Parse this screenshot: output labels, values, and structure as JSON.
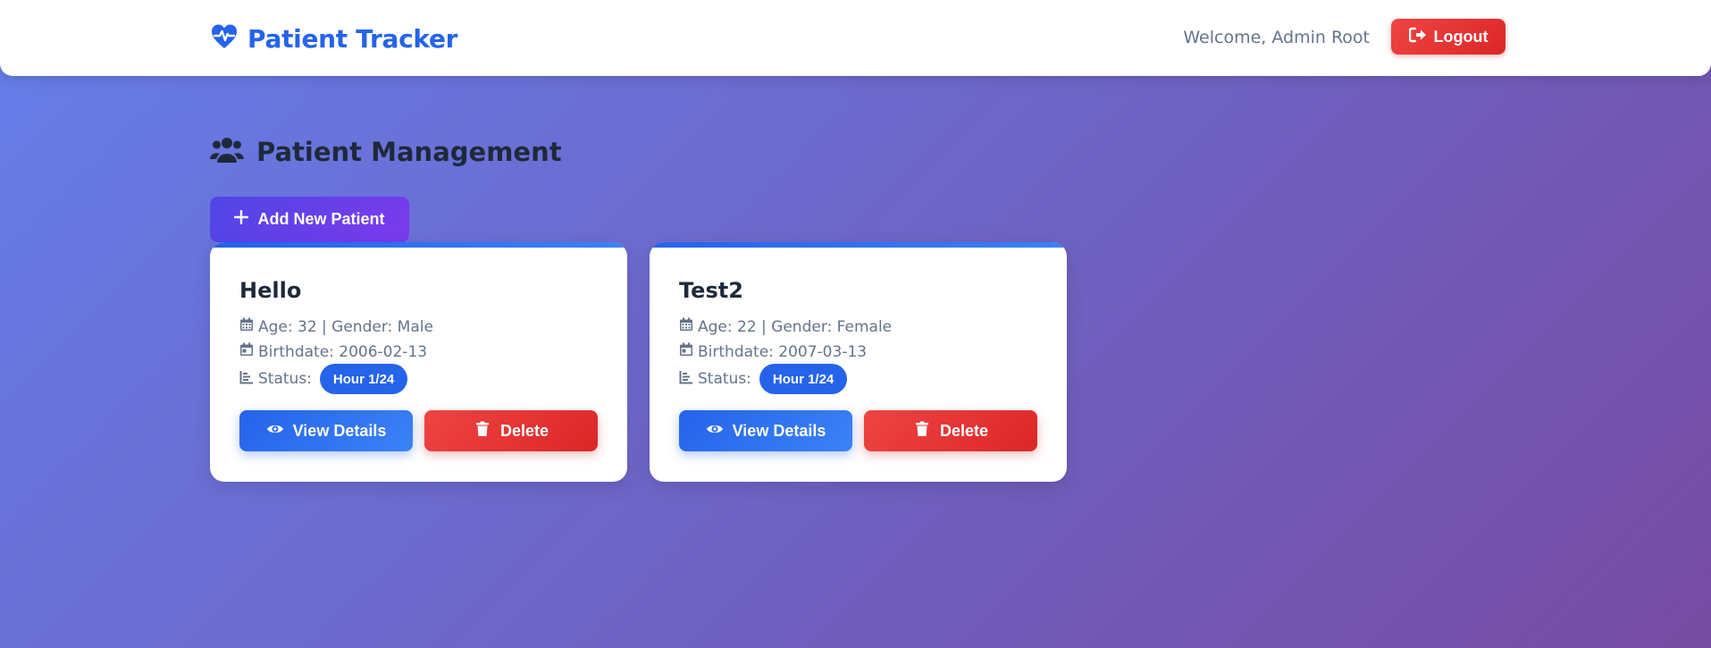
{
  "header": {
    "brand": "Patient Tracker",
    "welcome": "Welcome, Admin Root",
    "logout_label": "Logout"
  },
  "main": {
    "title": "Patient Management",
    "add_button_label": "Add New Patient"
  },
  "patients": [
    {
      "name": "Hello",
      "age_gender": "Age: 32 | Gender: Male",
      "birthdate": "Birthdate: 2006-02-13",
      "status_label": "Status:",
      "status_badge": "Hour 1/24",
      "view_label": "View Details",
      "delete_label": "Delete"
    },
    {
      "name": "Test2",
      "age_gender": "Age: 22 | Gender: Female",
      "birthdate": "Birthdate: 2007-03-13",
      "status_label": "Status:",
      "status_badge": "Hour 1/24",
      "view_label": "View Details",
      "delete_label": "Delete"
    }
  ],
  "icons": {
    "brand": "heartbeat-icon",
    "logout": "sign-out-icon",
    "section": "users-icon",
    "add": "plus-icon",
    "age": "calendar-icon",
    "birthdate": "calendar-day-icon",
    "status": "chart-icon",
    "view": "eye-icon",
    "delete": "trash-icon"
  },
  "colors": {
    "primary": "#2563eb",
    "danger": "#dc2626",
    "accent_purple": "#7c3aed",
    "background_start": "#667eea",
    "background_end": "#764ba2"
  }
}
